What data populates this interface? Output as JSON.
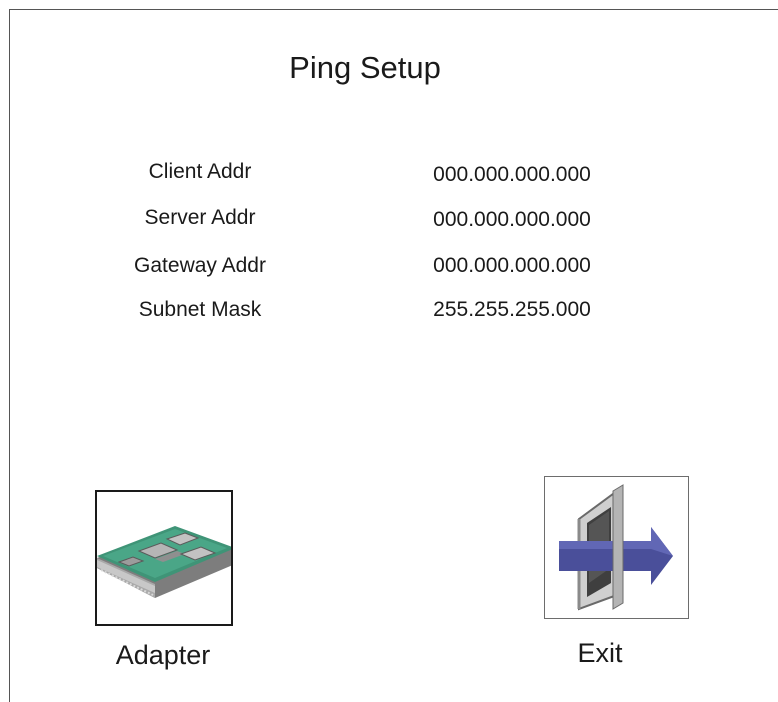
{
  "dialog": {
    "title": "Ping Setup"
  },
  "fields": [
    {
      "label": "Client Addr",
      "value": "000.000.000.000"
    },
    {
      "label": "Server Addr",
      "value": "000.000.000.000"
    },
    {
      "label": "Gateway Addr",
      "value": "000.000.000.000"
    },
    {
      "label": "Subnet Mask",
      "value": "255.255.255.000"
    }
  ],
  "buttons": {
    "adapter": {
      "label": "Adapter",
      "icon": "network-adapter-icon"
    },
    "exit": {
      "label": "Exit",
      "icon": "exit-door-arrow-icon"
    }
  },
  "colors": {
    "adapter_board": "#3f9477",
    "exit_arrow": "#4a4f9a"
  }
}
